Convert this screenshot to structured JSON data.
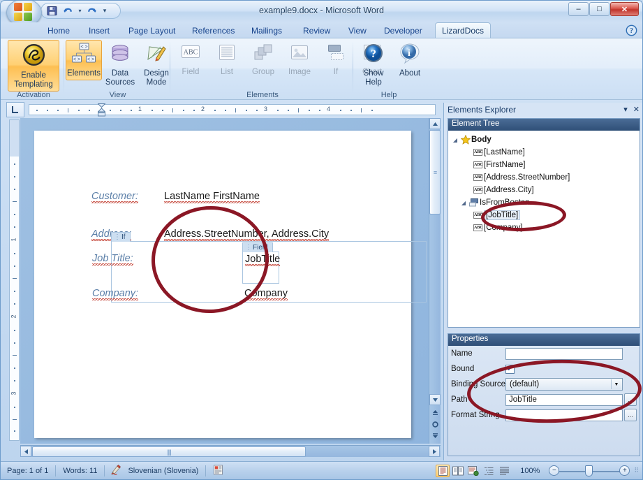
{
  "window": {
    "title": "example9.docx - Microsoft Word",
    "controls": {
      "minimize": "–",
      "restore": "□",
      "close": "✕"
    }
  },
  "quick_access": {
    "save": "save-icon",
    "undo": "undo-icon",
    "undo_dropdown": "▾",
    "redo": "redo-icon",
    "customize": "▾"
  },
  "ribbon": {
    "tabs": [
      {
        "label": "Home",
        "active": false
      },
      {
        "label": "Insert",
        "active": false
      },
      {
        "label": "Page Layout",
        "active": false
      },
      {
        "label": "References",
        "active": false
      },
      {
        "label": "Mailings",
        "active": false
      },
      {
        "label": "Review",
        "active": false
      },
      {
        "label": "View",
        "active": false
      },
      {
        "label": "Developer",
        "active": false
      },
      {
        "label": "LizardDocs",
        "active": true
      }
    ],
    "help_icon": "help-icon",
    "groups": [
      {
        "name": "Activation",
        "buttons": [
          {
            "label": "Enable\nTemplating",
            "label_line1": "Enable",
            "label_line2": "Templating",
            "selected": true,
            "enabled": true
          }
        ]
      },
      {
        "name": "View",
        "buttons": [
          {
            "label": "Elements",
            "selected": true,
            "enabled": true
          },
          {
            "label_line1": "Data",
            "label_line2": "Sources",
            "label": "Data Sources",
            "selected": false,
            "enabled": true
          },
          {
            "label_line1": "Design",
            "label_line2": "Mode",
            "label": "Design Mode",
            "selected": false,
            "enabled": true
          }
        ]
      },
      {
        "name": "Elements",
        "buttons": [
          {
            "label": "Field",
            "enabled": false
          },
          {
            "label": "List",
            "enabled": false
          },
          {
            "label": "Group",
            "enabled": false
          },
          {
            "label": "Image",
            "enabled": false
          },
          {
            "label": "If",
            "enabled": false
          },
          {
            "label": "Chart",
            "enabled": false
          }
        ]
      },
      {
        "name": "Help",
        "buttons": [
          {
            "label_line1": "Show",
            "label_line2": "Help",
            "label": "Show Help",
            "enabled": true
          },
          {
            "label": "About",
            "enabled": true
          }
        ]
      }
    ]
  },
  "ruler": {
    "tab_stop_icon": "left-tab-stop-icon",
    "horizontal_numbers": [
      "1",
      "2",
      "3",
      "4"
    ],
    "vertical_numbers": [
      "1",
      "2",
      "3"
    ]
  },
  "document": {
    "lines": [
      {
        "label": "Customer:",
        "value": "LastName  FirstName"
      },
      {
        "label": "Address:",
        "value": "Address.StreetNumber,  Address.City"
      },
      {
        "label": "Job Title:",
        "value": "JobTitle"
      },
      {
        "label": "Company:",
        "value": "Company"
      }
    ],
    "if_tag": "If",
    "field_tag": "Field"
  },
  "pane": {
    "title": "Elements Explorer",
    "dropdown_icon": "▾",
    "close_icon": "✕",
    "tree": {
      "header": "Element Tree",
      "nodes": [
        {
          "label": "Body",
          "icon": "star-icon",
          "depth": 0,
          "expander": "◢",
          "bold": true
        },
        {
          "label": "[LastName]",
          "icon": "abc-icon",
          "depth": 1,
          "expander": ""
        },
        {
          "label": "[FirstName]",
          "icon": "abc-icon",
          "depth": 1,
          "expander": ""
        },
        {
          "label": "[Address.StreetNumber]",
          "icon": "abc-icon",
          "depth": 1,
          "expander": ""
        },
        {
          "label": "[Address.City]",
          "icon": "abc-icon",
          "depth": 1,
          "expander": ""
        },
        {
          "label": "IsFromBoston",
          "icon": "if-icon",
          "depth": 1,
          "expander": "◢"
        },
        {
          "label": "[JobTitle]",
          "icon": "abc-icon",
          "depth": 2,
          "expander": "",
          "selected": true
        },
        {
          "label": "[Company]",
          "icon": "abc-icon",
          "depth": 2,
          "expander": ""
        }
      ]
    },
    "properties": {
      "header": "Properties",
      "rows": [
        {
          "name": "Name",
          "type": "text",
          "value": ""
        },
        {
          "name": "Bound",
          "type": "checkbox",
          "checked": true,
          "check_glyph": "✓"
        },
        {
          "name": "Binding Source",
          "type": "combo",
          "value": "(default)",
          "arrow": "▼"
        },
        {
          "name": "Path",
          "type": "text_ellipsis",
          "value": "JobTitle",
          "ellipsis": "..."
        },
        {
          "name": "Format String",
          "type": "text_ellipsis",
          "value": "",
          "ellipsis": "..."
        }
      ]
    }
  },
  "statusbar": {
    "page": "Page: 1 of 1",
    "words": "Words: 11",
    "proofing_icon": "proofing-errors-icon",
    "language": "Slovenian (Slovenia)",
    "macro_icon": "record-macro-icon",
    "view_buttons": [
      {
        "name": "print-layout",
        "glyph": "≡",
        "active": true
      },
      {
        "name": "full-screen-reading",
        "glyph": "◫",
        "active": false
      },
      {
        "name": "web-layout",
        "glyph": "☷",
        "active": false
      },
      {
        "name": "outline",
        "glyph": "☰",
        "active": false
      },
      {
        "name": "draft",
        "glyph": "☰",
        "active": false
      }
    ],
    "zoom": {
      "level": "100%",
      "minus": "−",
      "plus": "+"
    }
  },
  "annotations": {
    "color": "#8b1725",
    "regions": [
      "document-field-ellipse",
      "tree-jobtitle-ellipse",
      "properties-binding-ellipse"
    ]
  }
}
